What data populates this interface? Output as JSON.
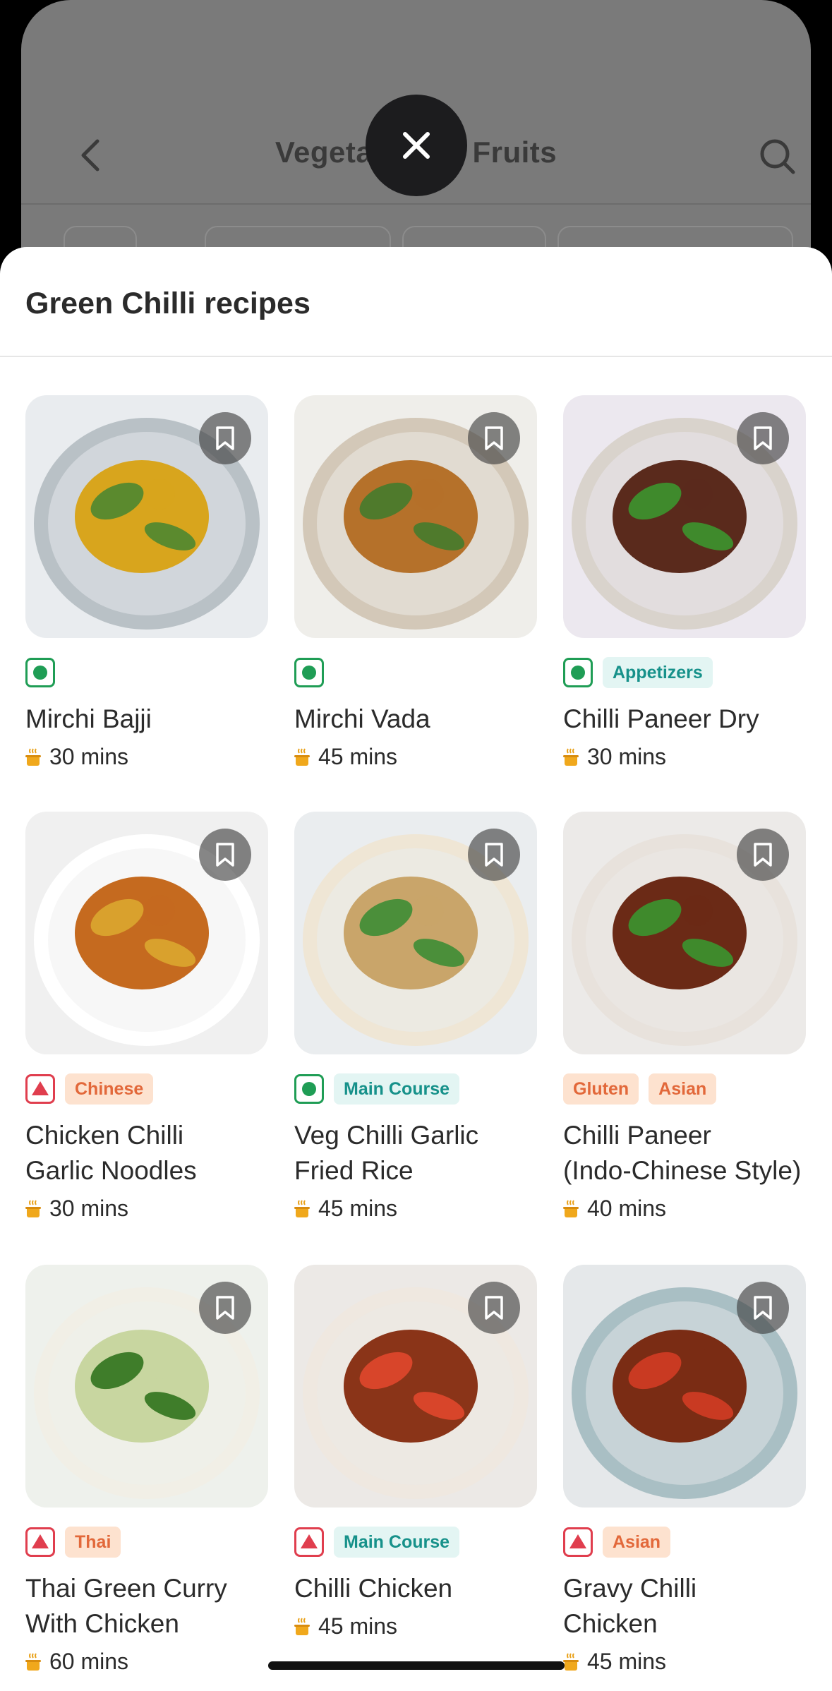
{
  "background_page": {
    "title": "Vegetables & Fruits"
  },
  "sheet": {
    "title": "Green Chilli recipes"
  },
  "recipes": [
    {
      "name": "Mirchi Bajji",
      "time": "30 mins",
      "diet": "veg",
      "tags": []
    },
    {
      "name": "Mirchi Vada",
      "time": "45 mins",
      "diet": "veg",
      "tags": []
    },
    {
      "name": "Chilli Paneer Dry",
      "time": "30 mins",
      "diet": "veg",
      "tags": [
        "Appetizers"
      ]
    },
    {
      "name": "Chicken Chilli",
      "name2": "Garlic Noodles",
      "time": "30 mins",
      "diet": "nonveg",
      "tags": [
        "Chinese"
      ]
    },
    {
      "name": "Veg Chilli Garlic",
      "name2": "Fried Rice",
      "time": "45 mins",
      "diet": "veg",
      "tags": [
        "Main Course"
      ]
    },
    {
      "name": "Chilli Paneer",
      "name2": "(Indo-Chinese Style)",
      "time": "40 mins",
      "diet": "none",
      "tags": [
        "Gluten",
        "Asian"
      ]
    },
    {
      "name": "Thai Green Curry",
      "name2": "With Chicken",
      "time": "60 mins",
      "diet": "nonveg",
      "tags": [
        "Thai"
      ]
    },
    {
      "name": "Chilli Chicken",
      "time": "45 mins",
      "diet": "nonveg",
      "tags": [
        "Main Course"
      ]
    },
    {
      "name": "Gravy Chilli",
      "name2": "Chicken",
      "time": "45 mins",
      "diet": "nonveg",
      "tags": [
        "Asian"
      ]
    }
  ],
  "icons": {
    "close": "close-icon",
    "back": "chevron-left-icon",
    "search": "search-icon",
    "bookmark": "bookmark-icon",
    "time": "cooking-pot-icon",
    "veg": "veg-indicator-icon",
    "nonveg": "nonveg-indicator-icon"
  },
  "colors": {
    "veg": "#1f9d55",
    "nonveg": "#e03e4e",
    "teal_tag": "#16918a",
    "orange_tag": "#e2683a"
  }
}
